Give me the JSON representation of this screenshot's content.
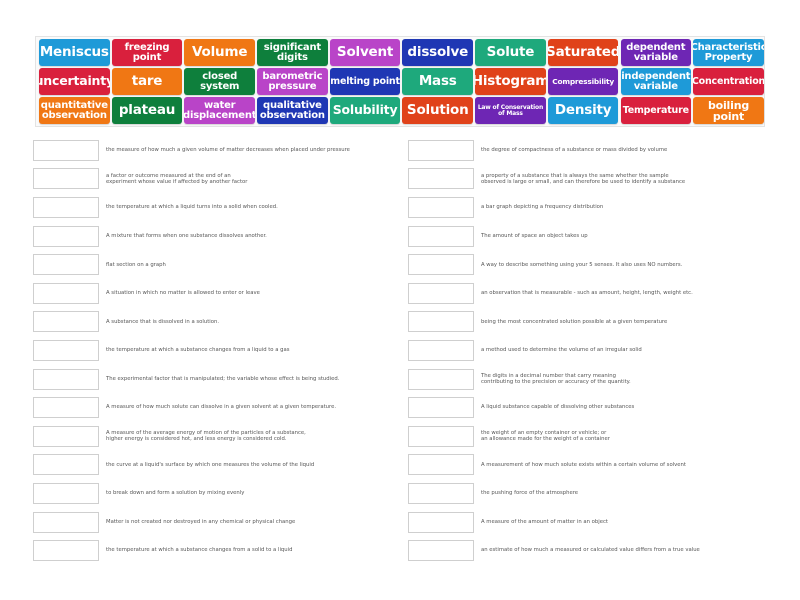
{
  "word_bank": [
    {
      "label": "Meniscus",
      "color": "#1e9ad8",
      "size": "xl"
    },
    {
      "label": "freezing\npoint",
      "color": "#d9203d",
      "size": "m"
    },
    {
      "label": "Volume",
      "color": "#f07714",
      "size": "xl"
    },
    {
      "label": "significant\ndigits",
      "color": "#0e7f3c",
      "size": "m"
    },
    {
      "label": "Solvent",
      "color": "#b944c8",
      "size": "xl"
    },
    {
      "label": "dissolve",
      "color": "#1f37b4",
      "size": "xl"
    },
    {
      "label": "Solute",
      "color": "#1ea97c",
      "size": "xl"
    },
    {
      "label": "Saturated",
      "color": "#e0421a",
      "size": "xl"
    },
    {
      "label": "dependent\nvariable",
      "color": "#6e26b4",
      "size": "m"
    },
    {
      "label": "Characteristic\nProperty",
      "color": "#1e9ad8",
      "size": "m"
    },
    {
      "label": "uncertainty",
      "color": "#d9203d",
      "size": "l"
    },
    {
      "label": "tare",
      "color": "#f07714",
      "size": "xl"
    },
    {
      "label": "closed\nsystem",
      "color": "#0e7f3c",
      "size": "m"
    },
    {
      "label": "barometric\npressure",
      "color": "#b944c8",
      "size": "m"
    },
    {
      "label": "melting point",
      "color": "#1f37b4",
      "size": "s"
    },
    {
      "label": "Mass",
      "color": "#1ea97c",
      "size": "xl"
    },
    {
      "label": "Histogram",
      "color": "#e0421a",
      "size": "xl"
    },
    {
      "label": "Compressibility",
      "color": "#6e26b4",
      "size": "xs2"
    },
    {
      "label": "independent\nvariable",
      "color": "#1e9ad8",
      "size": "m"
    },
    {
      "label": "Concentration",
      "color": "#d9203d",
      "size": "s"
    },
    {
      "label": "quantitative\nobservation",
      "color": "#f07714",
      "size": "m"
    },
    {
      "label": "plateau",
      "color": "#0e7f3c",
      "size": "xl"
    },
    {
      "label": "water\ndisplacement",
      "color": "#b944c8",
      "size": "m"
    },
    {
      "label": "qualitative\nobservation",
      "color": "#1f37b4",
      "size": "m"
    },
    {
      "label": "Solubility",
      "color": "#1ea97c",
      "size": "l"
    },
    {
      "label": "Solution",
      "color": "#e0421a",
      "size": "xl"
    },
    {
      "label": "Law of Conservation\nof Mass",
      "color": "#6e26b4",
      "size": "xs"
    },
    {
      "label": "Density",
      "color": "#1e9ad8",
      "size": "xl"
    },
    {
      "label": "Temperature",
      "color": "#d9203d",
      "size": "s"
    },
    {
      "label": "boiling point",
      "color": "#f07714",
      "size": "l2"
    }
  ],
  "definitions_left": [
    "the measure of how much a given volume of matter decreases when placed under pressure",
    "a factor or outcome measured at the end of an\nexperiment whose value if affected by another factor",
    "the temperature at which a liquid turns into a solid when cooled.",
    "A mixture that forms when one substance dissolves another.",
    "flat section on a graph",
    "A situation in which no matter is allowed to enter or leave",
    "A substance that is dissolved in a solution.",
    "the temperature at which a substance changes from a liquid to a gas",
    "The experimental factor that is manipulated; the variable whose effect is being studied.",
    "A measure of how much solute can dissolve in a given solvent at a given temperature.",
    "A measure of the average energy of motion of the particles of a substance,\nhigher energy is considered hot, and less energy is considered cold.",
    "the curve at a liquid's surface by which one measures the volume of the liquid",
    "to break down and form a solution by mixing evenly",
    "Matter is not created nor destroyed in any chemical or physical change",
    "the temperature at which a substance changes from a solid to a liquid"
  ],
  "definitions_right": [
    "the degree of compactness of a substance or mass divided by volume",
    "a property of a substance that is always the same whether the sample\nobserved is large or small, and can therefore be used to identify a substance",
    "a bar graph depicting a frequency distribution",
    "The amount of space an object takes up",
    "A way to describe something using your 5 senses. It also uses NO numbers.",
    "an observation that is measurable - such as amount, height, length, weight etc.",
    "being the most concentrated solution possible at a given temperature",
    "a method used to determine the volume of an irregular solid",
    "The digits in a decimal number that carry meaning\ncontributing to the precision or accuracy of the quantity.",
    "A liquid substance capable of dissolving other substances",
    "the weight of an empty container or vehicle; or\nan allowance made for the weight of a container",
    "A measurement of how much solute exists within a certain volume of solvent",
    "the pushing force of the atmosphere",
    "A measure of the amount of matter in an object",
    "an estimate of how much a measured or calculated value differs from a true value"
  ]
}
